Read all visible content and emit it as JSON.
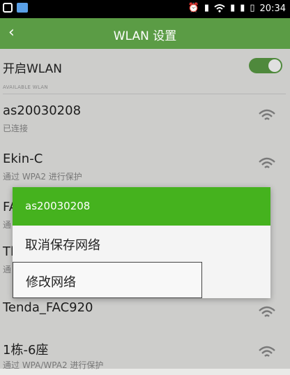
{
  "status_bar": {
    "time": "20:34"
  },
  "app_bar": {
    "title": "WLAN 设置"
  },
  "toggle": {
    "label": "开启WLAN",
    "on": true
  },
  "section_header": "AVAILABLE WLAN",
  "networks": [
    {
      "name": "as20030208",
      "status": "已连接"
    },
    {
      "name": "Ekin-C",
      "status": "通过 WPA2 进行保护"
    },
    {
      "name": "FA",
      "status": "通"
    },
    {
      "name": "Tl",
      "status": "通"
    },
    {
      "name": "Tenda_FAC920",
      "status": ""
    },
    {
      "name": "1栋-6座",
      "status": "通过 WPA/WPA2 进行保护"
    }
  ],
  "dialog": {
    "title": "as20030208",
    "items": [
      "取消保存网络",
      "修改网络"
    ]
  },
  "colors": {
    "app_bar": "#5b9c45",
    "dialog_header": "#45b21e",
    "background": "#eaeae8"
  }
}
